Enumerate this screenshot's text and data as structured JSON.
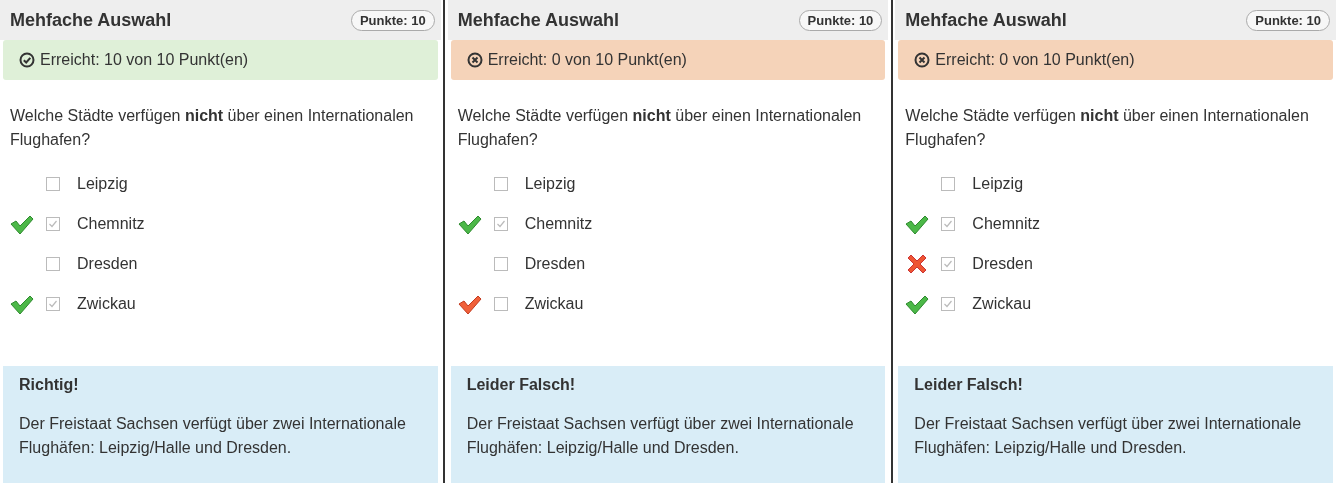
{
  "panels": [
    {
      "title": "Mehfache Auswahl",
      "points": "Punkte: 10",
      "result": {
        "kind": "success",
        "text": "Erreicht: 10 von 10 Punkt(en)"
      },
      "question": "Welche Städte verfügen **nicht** über einen Internationalen Flughafen?",
      "options": [
        {
          "label": "Leipzig",
          "checked": false,
          "kind": "plain"
        },
        {
          "label": "Chemnitz",
          "checked": true,
          "kind": "correct"
        },
        {
          "label": "Dresden",
          "checked": false,
          "kind": "plain"
        },
        {
          "label": "Zwickau",
          "checked": true,
          "kind": "correct"
        }
      ],
      "feedback": {
        "title": "Richtig!",
        "text": "Der Freistaat Sachsen verfügt über zwei Internationale Flughäfen: Leipzig/Halle und Dresden."
      }
    },
    {
      "title": "Mehfache Auswahl",
      "points": "Punkte: 10",
      "result": {
        "kind": "failure",
        "text": "Erreicht: 0 von 10 Punkt(en)"
      },
      "question": "Welche Städte verfügen **nicht** über einen Internationalen Flughafen?",
      "options": [
        {
          "label": "Leipzig",
          "checked": false,
          "kind": "plain"
        },
        {
          "label": "Chemnitz",
          "checked": true,
          "kind": "correct"
        },
        {
          "label": "Dresden",
          "checked": false,
          "kind": "plain"
        },
        {
          "label": "Zwickau",
          "checked": false,
          "kind": "missed"
        }
      ],
      "feedback": {
        "title": "Leider Falsch!",
        "text": "Der Freistaat Sachsen verfügt über zwei Internationale Flughäfen: Leipzig/Halle und Dresden."
      }
    },
    {
      "title": "Mehfache Auswahl",
      "points": "Punkte: 10",
      "result": {
        "kind": "failure",
        "text": "Erreicht: 0 von 10 Punkt(en)"
      },
      "question": "Welche Städte verfügen **nicht** über einen Internationalen Flughafen?",
      "options": [
        {
          "label": "Leipzig",
          "checked": false,
          "kind": "plain"
        },
        {
          "label": "Chemnitz",
          "checked": true,
          "kind": "correct"
        },
        {
          "label": "Dresden",
          "checked": true,
          "kind": "wrong"
        },
        {
          "label": "Zwickau",
          "checked": true,
          "kind": "correct"
        }
      ],
      "feedback": {
        "title": "Leider Falsch!",
        "text": "Der Freistaat Sachsen verfügt über zwei Internationale Flughäfen: Leipzig/Halle und Dresden."
      }
    }
  ]
}
